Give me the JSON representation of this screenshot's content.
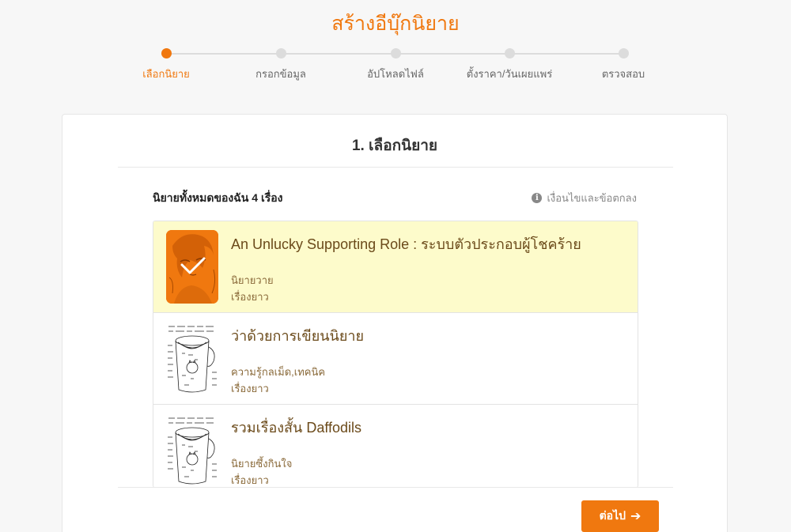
{
  "page": {
    "title": "สร้างอีบุ๊กนิยาย"
  },
  "stepper": {
    "steps": [
      {
        "label": "เลือกนิยาย",
        "active": true
      },
      {
        "label": "กรอกข้อมูล",
        "active": false
      },
      {
        "label": "อัปโหลดไฟล์",
        "active": false
      },
      {
        "label": "ตั้งราคา/วันเผยแพร่",
        "active": false
      },
      {
        "label": "ตรวจสอบ",
        "active": false
      }
    ]
  },
  "card": {
    "title": "1. เลือกนิยาย",
    "list_header": "นิยายทั้งหมดของฉัน 4 เรื่อง",
    "terms_icon": "info-icon",
    "terms_label": "เงื่อนไขและข้อตกลง"
  },
  "novels": [
    {
      "title": "An Unlucky Supporting Role : ระบบตัวประกอบผู้โชคร้าย",
      "genre": "นิยายวาย",
      "length": "เรื่องยาว",
      "selected": true,
      "cover": "anime-portrait-cover"
    },
    {
      "title": "ว่าด้วยการเขียนนิยาย",
      "genre": "ความรู้กลเม็ด,เทคนิค",
      "length": "เรื่องยาว",
      "selected": false,
      "cover": "coffee-cup-sketch-cover"
    },
    {
      "title": "รวมเรื่องสั้น Daffodils",
      "genre": "นิยายซึ้งกินใจ",
      "length": "เรื่องยาว",
      "selected": false,
      "cover": "coffee-cup-sketch-cover"
    }
  ],
  "actions": {
    "next_label": "ต่อไป",
    "next_icon": "arrow-right-icon"
  },
  "colors": {
    "accent": "#f0780f",
    "selected_bg": "#fdfbcb",
    "title_brown": "#6b4a1a"
  }
}
